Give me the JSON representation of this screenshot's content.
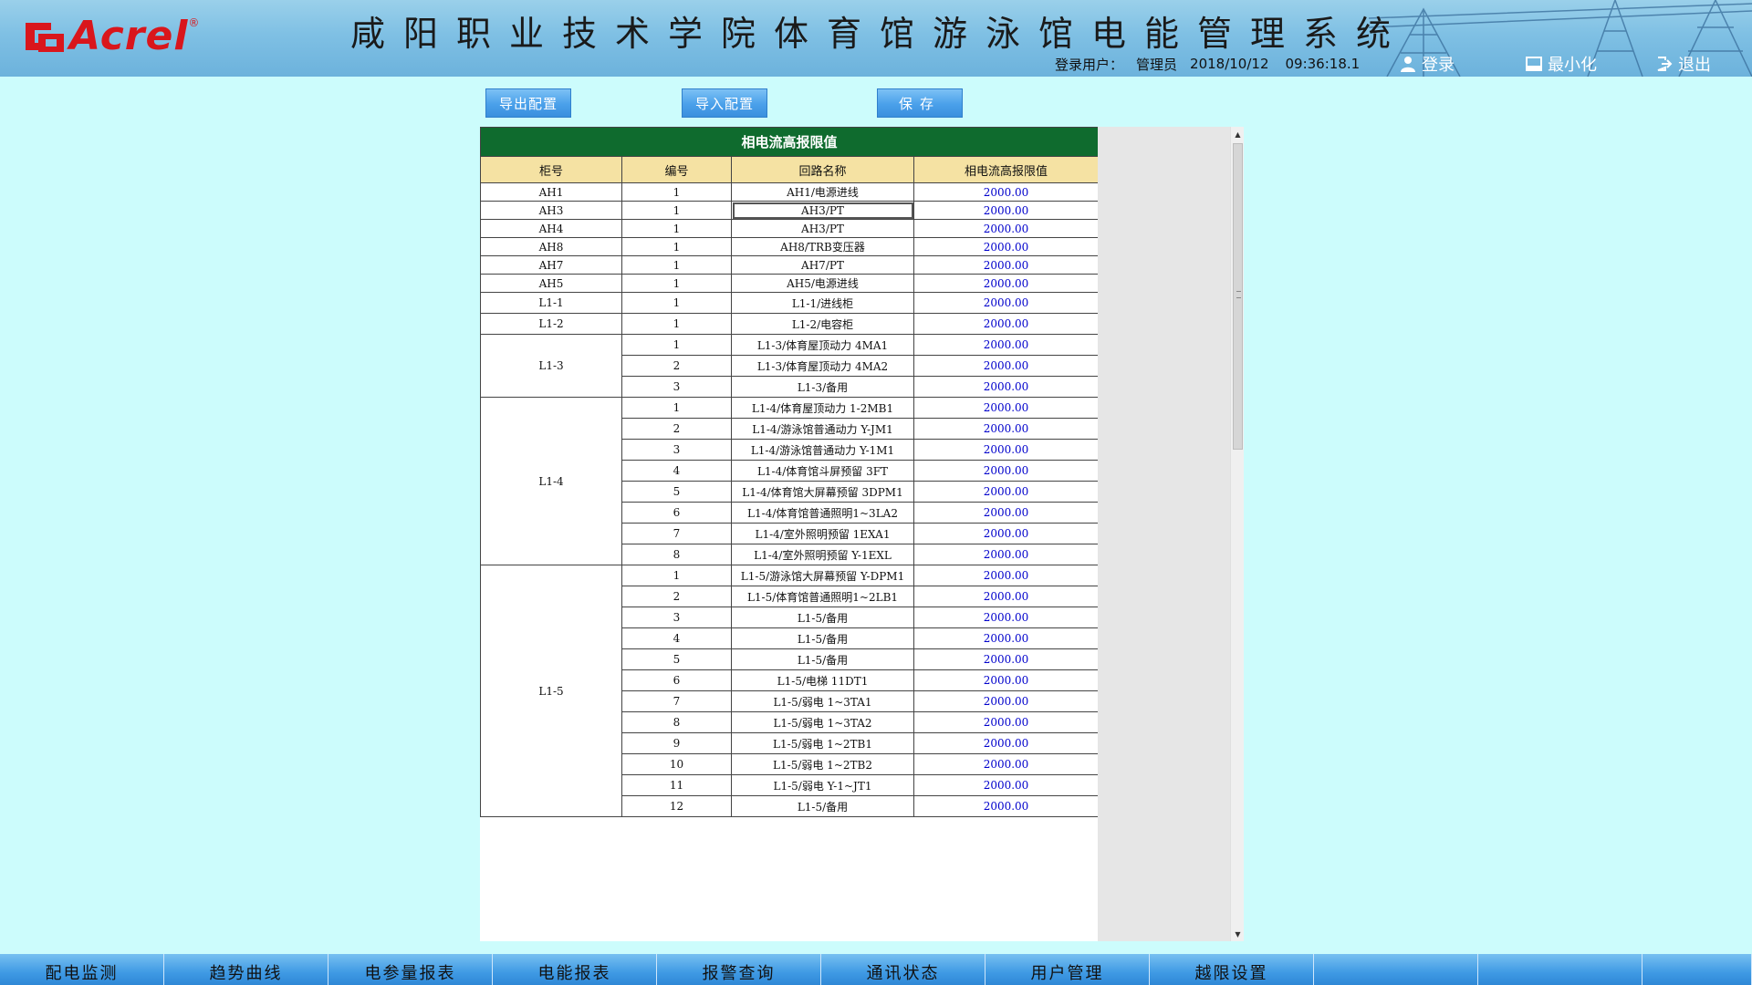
{
  "header": {
    "logo_text": "Acrel",
    "logo_reg": "®",
    "title": "咸阳职业技术学院体育馆游泳馆电能管理系统",
    "user_label": "登录用户：",
    "user_name": "管理员",
    "date": "2018/10/12",
    "time": "09:36:18.1",
    "login_label": "登录",
    "minimize_label": "最小化",
    "exit_label": "退出"
  },
  "toolbar": {
    "export_label": "导出配置",
    "import_label": "导入配置",
    "save_label": "保存"
  },
  "table": {
    "title": "相电流高报限值",
    "columns": [
      "柜号",
      "编号",
      "回路名称",
      "相电流高报限值"
    ],
    "rows": [
      {
        "cabinet": "AH1",
        "span": 1,
        "no": "1",
        "name": "AH1/电源进线",
        "value": "2000.00"
      },
      {
        "cabinet": "AH3",
        "span": 1,
        "no": "1",
        "name": "AH3/PT",
        "value": "2000.00",
        "selected": true
      },
      {
        "cabinet": "AH4",
        "span": 1,
        "no": "1",
        "name": "AH3/PT",
        "value": "2000.00"
      },
      {
        "cabinet": "AH8",
        "span": 1,
        "no": "1",
        "name": "AH8/TRB变压器",
        "value": "2000.00"
      },
      {
        "cabinet": "AH7",
        "span": 1,
        "no": "1",
        "name": "AH7/PT",
        "value": "2000.00"
      },
      {
        "cabinet": "AH5",
        "span": 1,
        "no": "1",
        "name": "AH5/电源进线",
        "value": "2000.00"
      },
      {
        "cabinet": "L1-1",
        "span": 1,
        "no": "1",
        "name": "L1-1/进线柜",
        "value": "2000.00"
      },
      {
        "cabinet": "L1-2",
        "span": 1,
        "no": "1",
        "name": "L1-2/电容柜",
        "value": "2000.00"
      },
      {
        "cabinet": "L1-3",
        "span": 3,
        "no": "1",
        "name": "L1-3/体育屋顶动力 4MA1",
        "value": "2000.00"
      },
      {
        "no": "2",
        "name": "L1-3/体育屋顶动力 4MA2",
        "value": "2000.00"
      },
      {
        "no": "3",
        "name": "L1-3/备用",
        "value": "2000.00"
      },
      {
        "cabinet": "L1-4",
        "span": 8,
        "no": "1",
        "name": "L1-4/体育屋顶动力 1-2MB1",
        "value": "2000.00"
      },
      {
        "no": "2",
        "name": "L1-4/游泳馆普通动力 Y-JM1",
        "value": "2000.00"
      },
      {
        "no": "3",
        "name": "L1-4/游泳馆普通动力 Y-1M1",
        "value": "2000.00"
      },
      {
        "no": "4",
        "name": "L1-4/体育馆斗屏预留 3FT",
        "value": "2000.00"
      },
      {
        "no": "5",
        "name": "L1-4/体育馆大屏幕预留 3DPM1",
        "value": "2000.00"
      },
      {
        "no": "6",
        "name": "L1-4/体育馆普通照明1~3LA2",
        "value": "2000.00"
      },
      {
        "no": "7",
        "name": "L1-4/室外照明预留 1EXA1",
        "value": "2000.00"
      },
      {
        "no": "8",
        "name": "L1-4/室外照明预留 Y-1EXL",
        "value": "2000.00"
      },
      {
        "cabinet": "L1-5",
        "span": 12,
        "no": "1",
        "name": "L1-5/游泳馆大屏幕预留 Y-DPM1",
        "value": "2000.00"
      },
      {
        "no": "2",
        "name": "L1-5/体育馆普通照明1~2LB1",
        "value": "2000.00"
      },
      {
        "no": "3",
        "name": "L1-5/备用",
        "value": "2000.00"
      },
      {
        "no": "4",
        "name": "L1-5/备用",
        "value": "2000.00"
      },
      {
        "no": "5",
        "name": "L1-5/备用",
        "value": "2000.00"
      },
      {
        "no": "6",
        "name": "L1-5/电梯 11DT1",
        "value": "2000.00"
      },
      {
        "no": "7",
        "name": "L1-5/弱电 1~3TA1",
        "value": "2000.00"
      },
      {
        "no": "8",
        "name": "L1-5/弱电 1~3TA2",
        "value": "2000.00"
      },
      {
        "no": "9",
        "name": "L1-5/弱电 1~2TB1",
        "value": "2000.00"
      },
      {
        "no": "10",
        "name": "L1-5/弱电 1~2TB2",
        "value": "2000.00"
      },
      {
        "no": "11",
        "name": "L1-5/弱电 Y-1~JT1",
        "value": "2000.00"
      },
      {
        "no": "12",
        "name": "L1-5/备用",
        "value": "2000.00"
      }
    ]
  },
  "nav": {
    "items": [
      "配电监测",
      "趋势曲线",
      "电参量报表",
      "电能报表",
      "报警查询",
      "通讯状态",
      "用户管理",
      "越限设置"
    ]
  },
  "colors": {
    "background": "#ccfcfc",
    "table_title_bg": "#0f6b2e",
    "table_header_bg": "#f5e2a3",
    "value_text": "#0000cc",
    "brand_red": "#d9161c"
  },
  "icons": {
    "login": "user-icon",
    "minimize": "minimize-icon",
    "exit": "exit-icon"
  }
}
